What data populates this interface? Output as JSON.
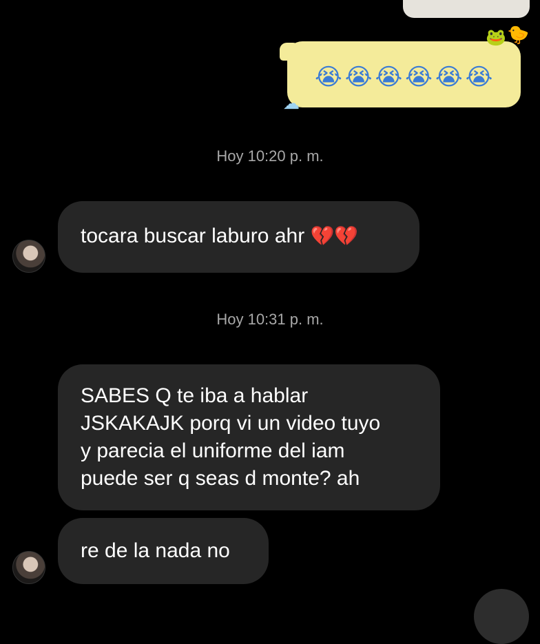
{
  "conversation": {
    "sent_message": {
      "emojis": "😭😭😭😭😭😭",
      "decorations": [
        "frog-sticker",
        "duck-sticker",
        "cloud-sticker"
      ]
    },
    "timestamps": [
      "Hoy 10:20 p. m.",
      "Hoy 10:31 p. m."
    ],
    "received_messages": [
      {
        "text": "tocara buscar laburo ahr",
        "emoji": "💔💔"
      },
      {
        "lines": [
          "SABES Q te iba a hablar",
          "JSKAKAJK porq vi un video tuyo",
          "y parecia el uniforme del iam",
          "puede ser q seas d monte? ah"
        ]
      },
      {
        "text": "re de la nada no"
      }
    ]
  },
  "colors": {
    "background": "#000000",
    "received_bubble": "#262626",
    "sent_bubble": "#f4eb9a",
    "timestamp_text": "#a8a8a8"
  }
}
